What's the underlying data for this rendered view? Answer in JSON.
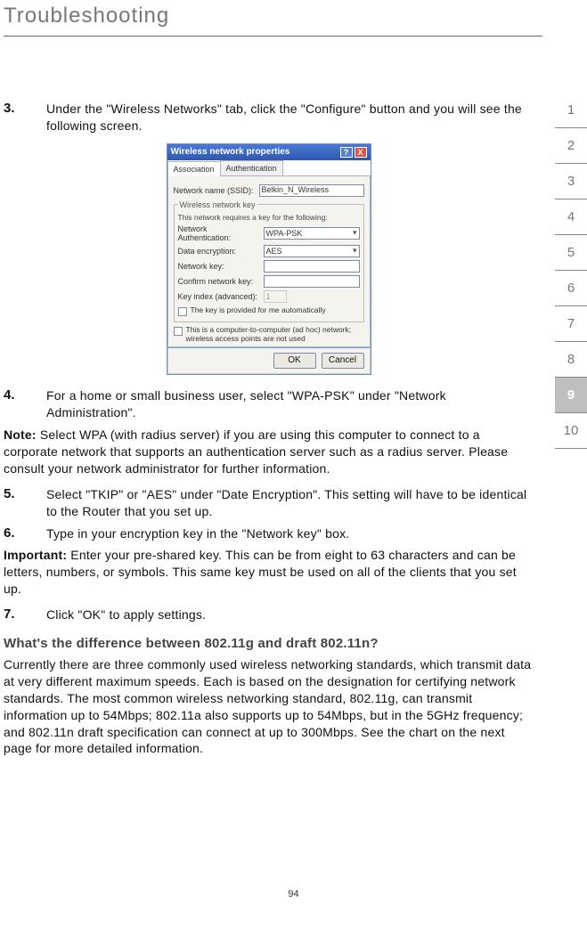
{
  "header": {
    "title": "Troubleshooting"
  },
  "sidebar": {
    "items": [
      {
        "n": "1",
        "active": false
      },
      {
        "n": "2",
        "active": false
      },
      {
        "n": "3",
        "active": false
      },
      {
        "n": "4",
        "active": false
      },
      {
        "n": "5",
        "active": false
      },
      {
        "n": "6",
        "active": false
      },
      {
        "n": "7",
        "active": false
      },
      {
        "n": "8",
        "active": false
      },
      {
        "n": "9",
        "active": true
      },
      {
        "n": "10",
        "active": false
      }
    ]
  },
  "steps": {
    "s3": {
      "num": "3.",
      "text": "Under the \"Wireless Networks\" tab, click the \"Configure\" button and you will see the following screen."
    },
    "s4": {
      "num": "4.",
      "text": "For a home or small business user, select \"WPA-PSK\" under \"Network Administration\"."
    },
    "s5": {
      "num": "5.",
      "text": "Select \"TKIP\" or \"AES\" under \"Date Encryption\". This setting will have to be identical to the Router that you set up."
    },
    "s6": {
      "num": "6.",
      "text": "Type in your encryption key in the \"Network key\" box."
    },
    "s7": {
      "num": "7.",
      "text": "Click \"OK\" to apply settings."
    }
  },
  "note": {
    "label": "Note:",
    "text": " Select WPA (with radius server) if you are using this computer to connect to a corporate network that supports an authentication server such as a radius server. Please consult your network administrator for further information."
  },
  "important": {
    "label": "Important:",
    "text": " Enter your pre-shared key. This can be from eight to 63 characters and can be letters, numbers, or symbols. This same key must be used on all of the clients that you set up."
  },
  "diff": {
    "title": "What's the difference between 802.11g and draft 802.11n?",
    "body": "Currently there are three commonly used wireless networking standards, which transmit data at very different maximum speeds. Each is based on the designation for certifying network standards. The most common wireless networking standard, 802.11g, can transmit information up to 54Mbps; 802.11a also supports up to 54Mbps, but in the 5GHz frequency; and 802.11n draft specification can connect at up to 300Mbps. See the chart on the next page for more detailed information."
  },
  "dialog": {
    "title": "Wireless network properties",
    "help": "?",
    "close": "X",
    "tabs": {
      "assoc": "Association",
      "auth": "Authentication"
    },
    "ssid_label": "Network name (SSID):",
    "ssid_value": "Belkin_N_Wireless",
    "wnk_legend": "Wireless network key",
    "wnk_sub": "This network requires a key for the following:",
    "na_label": "Network Authentication:",
    "na_value": "WPA-PSK",
    "de_label": "Data encryption:",
    "de_value": "AES",
    "nk_label": "Network key:",
    "cnk_label": "Confirm network key:",
    "ki_label": "Key index (advanced):",
    "ki_value": "1",
    "auto_label": "The key is provided for me automatically",
    "adhoc_label": "This is a computer-to-computer (ad hoc) network; wireless access points are not used",
    "ok": "OK",
    "cancel": "Cancel"
  },
  "page_number": "94"
}
